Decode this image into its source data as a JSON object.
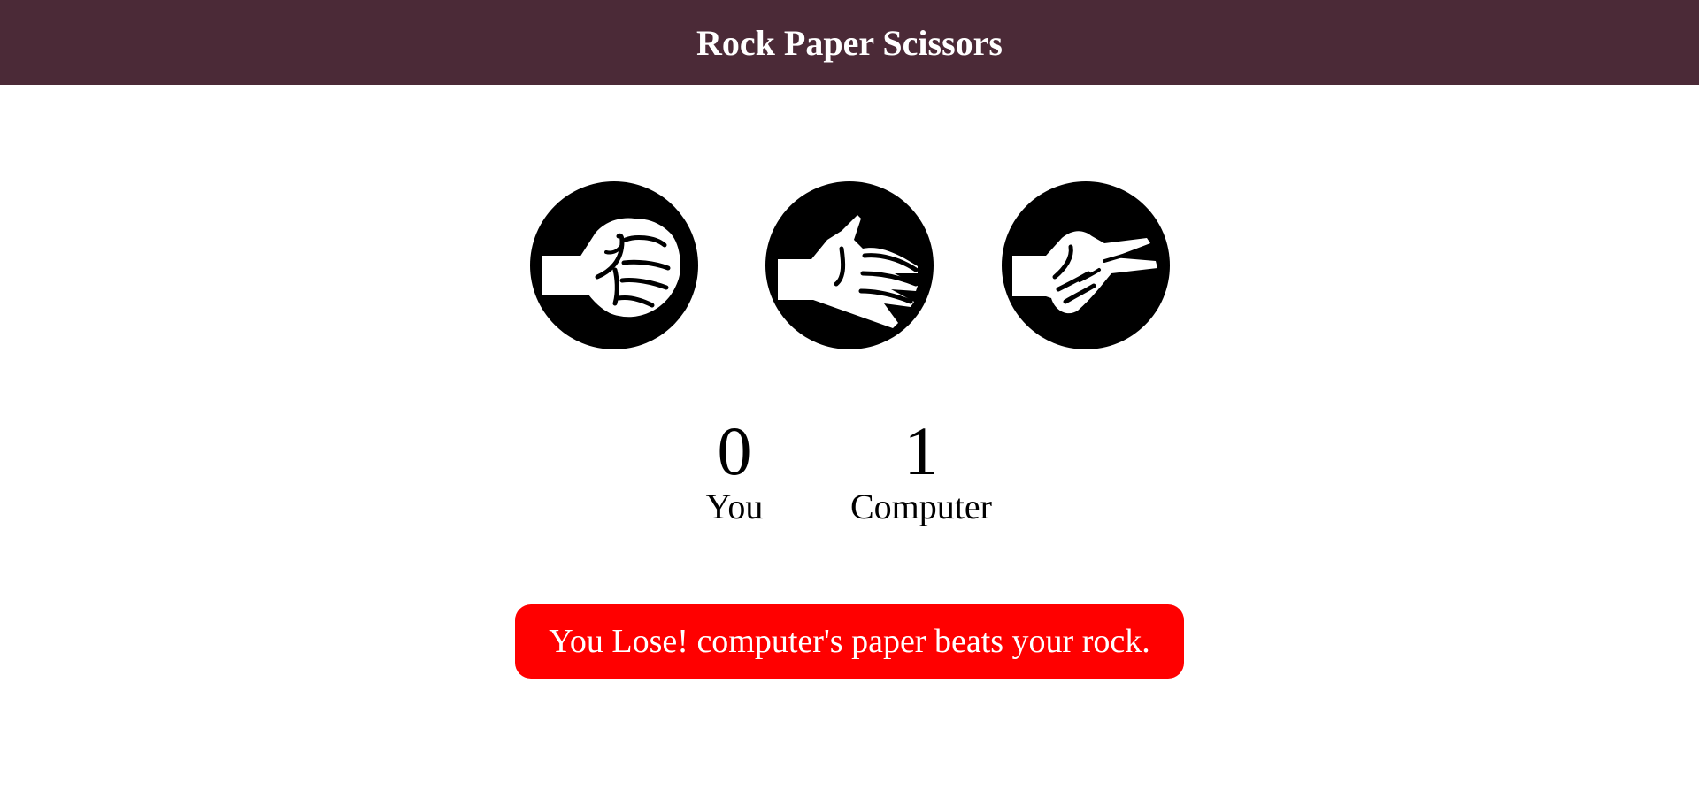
{
  "header": {
    "title": "Rock Paper Scissors",
    "background": "#4b2a37"
  },
  "choices": [
    {
      "id": "rock",
      "icon": "rock-hand-icon"
    },
    {
      "id": "paper",
      "icon": "paper-hand-icon"
    },
    {
      "id": "scissors",
      "icon": "scissors-hand-icon"
    }
  ],
  "scoreboard": {
    "user": {
      "score": "0",
      "label": "You"
    },
    "computer": {
      "score": "1",
      "label": "Computer"
    }
  },
  "result": {
    "message": "You Lose! computer's paper beats your rock.",
    "status": "lose",
    "color": "#ff0000"
  }
}
